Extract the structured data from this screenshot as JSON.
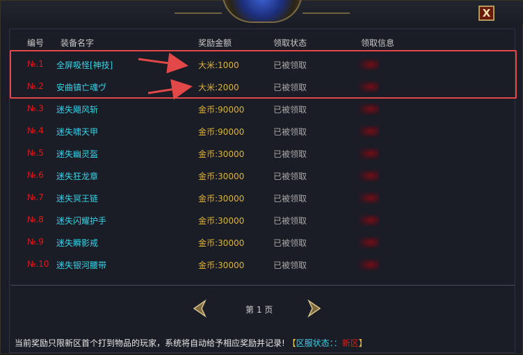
{
  "headers": {
    "no": "编号",
    "name": "装备名字",
    "reward": "奖励金额",
    "status": "领取状态",
    "info": "领取信息"
  },
  "rows": [
    {
      "no": "№.1",
      "name": "全屏吸怪[神技]",
      "reward": "大米:1000",
      "status": "已被领取"
    },
    {
      "no": "№.2",
      "name": "安曲镇亡魂ヴ",
      "reward": "大米:2000",
      "status": "已被领取"
    },
    {
      "no": "№.3",
      "name": "迷失飓风斩",
      "reward": "金币:90000",
      "status": "已被领取"
    },
    {
      "no": "№.4",
      "name": "迷失啸天甲",
      "reward": "金币:90000",
      "status": "已被领取"
    },
    {
      "no": "№.5",
      "name": "迷失幽灵盔",
      "reward": "金币:30000",
      "status": "已被领取"
    },
    {
      "no": "№.6",
      "name": "迷失狂龙章",
      "reward": "金币:30000",
      "status": "已被领取"
    },
    {
      "no": "№.7",
      "name": "迷失冥王链",
      "reward": "金币:30000",
      "status": "已被领取"
    },
    {
      "no": "№.8",
      "name": "迷失闪耀护手",
      "reward": "金币:30000",
      "status": "已被领取"
    },
    {
      "no": "№.9",
      "name": "迷失瞬影戒",
      "reward": "金币:30000",
      "status": "已被领取"
    },
    {
      "no": "№.10",
      "name": "迷失银河腰带",
      "reward": "金币:30000",
      "status": "已被领取"
    }
  ],
  "pager": {
    "text": "第 1 页"
  },
  "footer": {
    "notice": "当前奖励只限新区首个打到物品的玩家，系统将自动给予相应奖励并记录!",
    "bracket_open": "【",
    "server_label": "区服状态：：",
    "server_value": "新区",
    "bracket_close": "】"
  },
  "close_label": "X",
  "colors": {
    "number": "#e01b1b",
    "name": "#38d4e8",
    "reward": "#e0b23a",
    "status": "#a8a8a8",
    "highlight": "#e24848"
  }
}
